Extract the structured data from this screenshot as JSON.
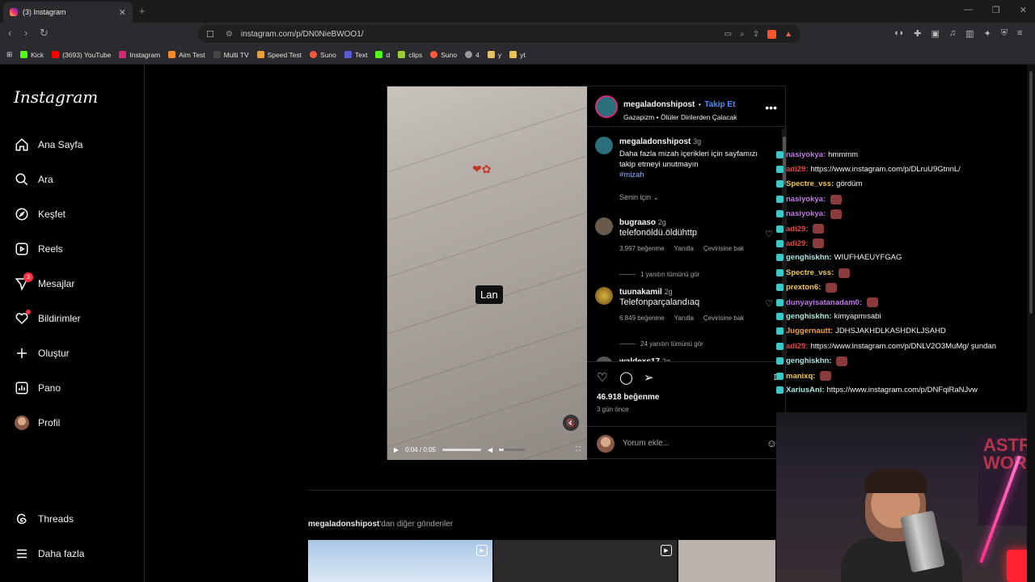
{
  "browser": {
    "tab_title": "(3) Instagram",
    "url": "instagram.com/p/DN0NieBWOO1/",
    "bookmarks": [
      "Kick",
      "(3693) YouTube",
      "Instagram",
      "Aim Test",
      "Multi TV",
      "Speed Test",
      "Suno",
      "Text",
      "d",
      "clips",
      "Suno",
      "4",
      "y",
      "yt"
    ]
  },
  "sidebar": {
    "logo": "Instagram",
    "items": [
      {
        "label": "Ana Sayfa",
        "icon": "home-icon"
      },
      {
        "label": "Ara",
        "icon": "search-icon"
      },
      {
        "label": "Keşfet",
        "icon": "compass-icon"
      },
      {
        "label": "Reels",
        "icon": "reels-icon"
      },
      {
        "label": "Mesajlar",
        "icon": "messenger-icon",
        "badge": "3"
      },
      {
        "label": "Bildirimler",
        "icon": "heart-icon"
      },
      {
        "label": "Oluştur",
        "icon": "plus-icon"
      },
      {
        "label": "Pano",
        "icon": "dashboard-icon"
      },
      {
        "label": "Profil",
        "icon": "avatar"
      }
    ],
    "bottom": [
      {
        "label": "Threads",
        "icon": "threads-icon"
      },
      {
        "label": "Daha fazla",
        "icon": "menu-icon"
      }
    ]
  },
  "post": {
    "video": {
      "caption_overlay": "Lan",
      "time": "0:04 / 0:05"
    },
    "header": {
      "username": "megaladonshipost",
      "separator": "•",
      "follow": "Takip Et",
      "subtitle": "Gazapizm • Ölüler Dirilerden Çalacak"
    },
    "caption": {
      "username": "megaladonshipost",
      "time": "3g",
      "text": "Daha fazla mizah içerikleri için sayfamızı takip etmeyi unutmayın",
      "hashtag": "#mizah"
    },
    "sort": "Senin için",
    "comments": [
      {
        "username": "bugraaso",
        "time": "2g",
        "text": "telefonöldü.öldühttp",
        "likes": "3.997 beğenme",
        "reply": "Yanıtla",
        "translate": "Çevirisine bak",
        "replies": "1 yanıtın tümünü gör"
      },
      {
        "username": "tuunakamil",
        "time": "2g",
        "text": "Telefonparçalandıaq",
        "likes": "6.849 beğenme",
        "reply": "Yanıtla",
        "translate": "Çevirisine bak",
        "replies": "24 yanıtın tümünü gör"
      },
      {
        "username": "waldexs17",
        "time": "2g"
      }
    ],
    "like_count": "46.918 beğenme",
    "posted": "3 gün önce",
    "add_comment_placeholder": "Yorum ekle..."
  },
  "more_posts": {
    "username": "megaladonshipost",
    "suffix": "'dan diğer gönderiler"
  },
  "chat": [
    {
      "user": "nasiyokya",
      "color": "#c07be8",
      "msg": "hmmmm"
    },
    {
      "user": "adi29",
      "color": "#e04848",
      "msg": "https://www.instagram.com/p/DLruU9GtnnL/"
    },
    {
      "user": "Spectre_vss",
      "color": "#f2c84b",
      "msg": "gördüm"
    },
    {
      "user": "nasiyokya",
      "color": "#c07be8",
      "msg": ""
    },
    {
      "user": "nasiyokya",
      "color": "#c07be8",
      "msg": ""
    },
    {
      "user": "adi29",
      "color": "#e04848",
      "msg": ""
    },
    {
      "user": "adi29",
      "color": "#e04848",
      "msg": ""
    },
    {
      "user": "genghiskhn",
      "color": "#a7e8e0",
      "msg": "WIUFHAEUYFGAG"
    },
    {
      "user": "Spectre_vss",
      "color": "#f2c84b",
      "msg": ""
    },
    {
      "user": "prexton6",
      "color": "#f2c84b",
      "msg": ""
    },
    {
      "user": "dunyayisatanadam0",
      "color": "#c07be8",
      "msg": ""
    },
    {
      "user": "genghiskhn",
      "color": "#a7e8e0",
      "msg": "kimyapmısabi"
    },
    {
      "user": "Juggernautt",
      "color": "#f2a03b",
      "msg": "JDHSJAKHDLKASHDKLJSAHD"
    },
    {
      "user": "adi29",
      "color": "#e04848",
      "msg": "https://www.instagram.com/p/DNLV2O3MuMg/ şundan"
    },
    {
      "user": "genghiskhn",
      "color": "#a7e8e0",
      "msg": ""
    },
    {
      "user": "manixq",
      "color": "#f2c84b",
      "msg": ""
    },
    {
      "user": "XariusAni",
      "color": "#a7e8e0",
      "msg": "https://www.instagram.com/p/DNFqiRaNJvw"
    }
  ],
  "webcam_poster": "ASTRO WORLD"
}
